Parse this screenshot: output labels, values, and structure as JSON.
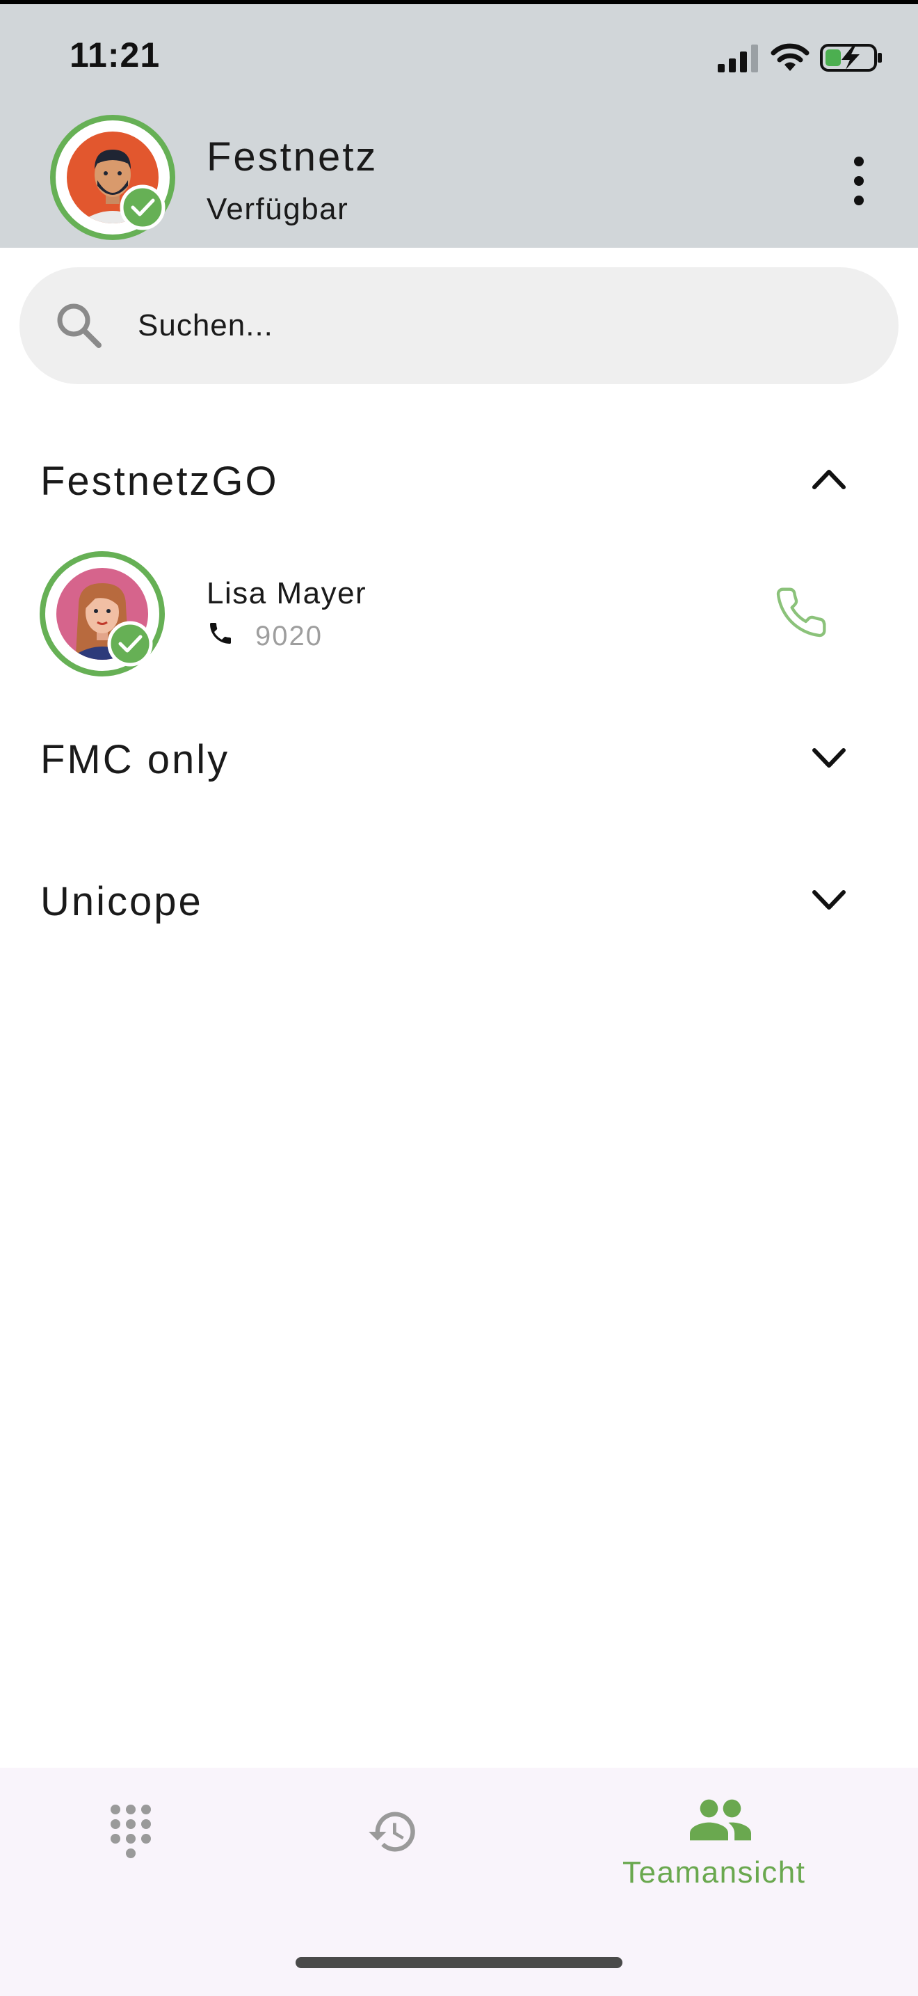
{
  "status_bar": {
    "time": "11:21"
  },
  "profile": {
    "name": "Festnetz",
    "status": "Verfügbar",
    "presence_color": "#66b055"
  },
  "search": {
    "placeholder": "Suchen..."
  },
  "groups": [
    {
      "title": "FestnetzGO",
      "expanded": true,
      "contacts": [
        {
          "name": "Lisa Mayer",
          "extension": "9020",
          "presence": "available"
        }
      ]
    },
    {
      "title": "FMC only",
      "expanded": false
    },
    {
      "title": "Unicope",
      "expanded": false
    }
  ],
  "bottom_nav": {
    "items": [
      {
        "icon": "dialpad-icon",
        "label": "",
        "active": false
      },
      {
        "icon": "history-icon",
        "label": "",
        "active": false
      },
      {
        "icon": "team-icon",
        "label": "Teamansicht",
        "active": true
      }
    ]
  },
  "colors": {
    "accent": "#6aa84f",
    "header_bg": "#d1d6d9",
    "nav_bg": "#f9f4fb"
  }
}
